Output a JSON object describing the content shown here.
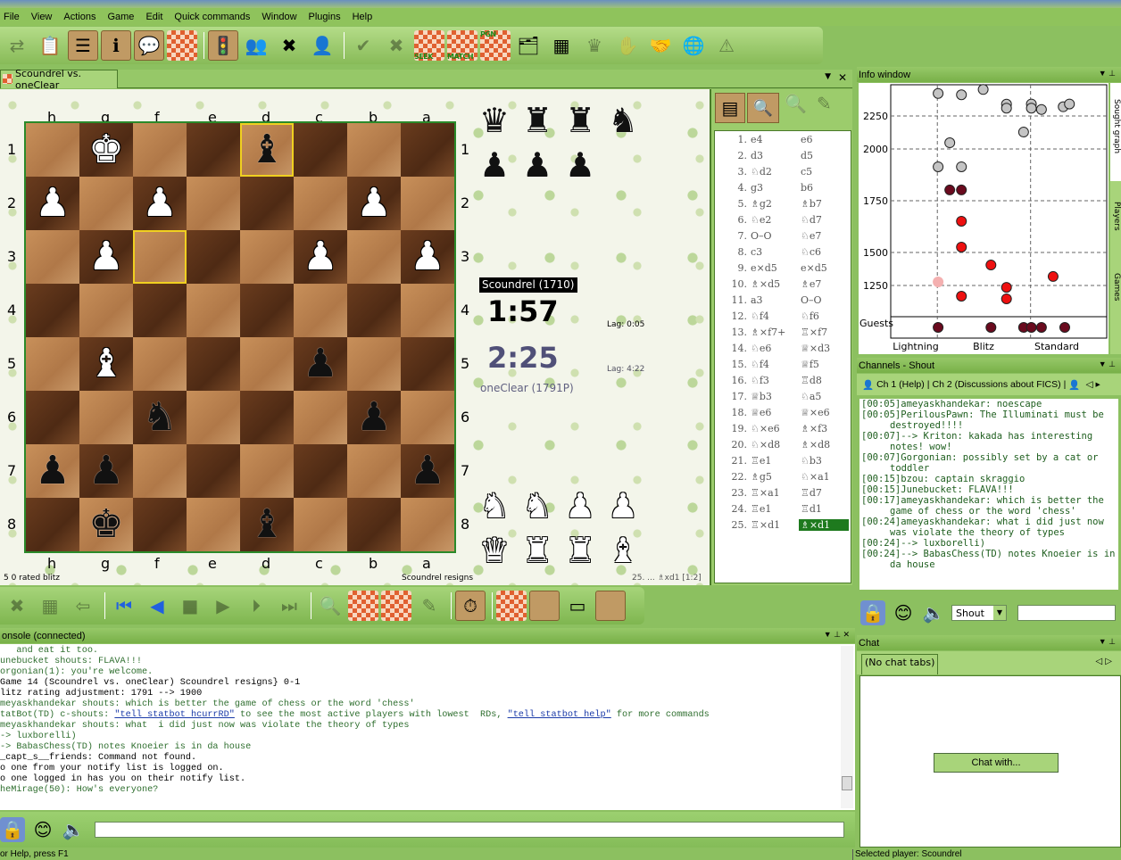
{
  "menu": [
    "File",
    "View",
    "Actions",
    "Game",
    "Edit",
    "Quick commands",
    "Window",
    "Plugins",
    "Help"
  ],
  "toolbar": {
    "seek_label": "SEEK",
    "match_label": "MATCH",
    "pgn_label": "PGN"
  },
  "game_tab": {
    "title": "Scoundrel vs. oneClear"
  },
  "board": {
    "files": [
      "h",
      "g",
      "f",
      "e",
      "d",
      "c",
      "b",
      "a"
    ],
    "ranks": [
      "1",
      "2",
      "3",
      "4",
      "5",
      "6",
      "7",
      "8"
    ],
    "rows": [
      ".K..b...",
      "P.P...P.",
      ".P...P.P",
      "........",
      ".B...p..",
      "..n...p.",
      "pp.....p",
      ".k..b..."
    ],
    "highlight_squares": [
      "d1",
      "f3"
    ],
    "captured_top": [
      [
        "q",
        "r",
        "r",
        "n"
      ],
      [
        "p",
        "p",
        "p"
      ]
    ],
    "captured_bottom": [
      [
        "N",
        "N",
        "P",
        "P"
      ],
      [
        "Q",
        "R",
        "R",
        "B"
      ]
    ]
  },
  "clocks": {
    "top_player": "Scoundrel (1710)",
    "top_time": "1:57",
    "top_lag": "Lag:  0:05",
    "bottom_player": "oneClear (1791P)",
    "bottom_time": "2:25",
    "bottom_lag": "Lag:  4:22"
  },
  "board_footer": {
    "game_type": "5 0 rated blitz",
    "result": "Scoundrel resigns",
    "last_move": "25. ... ♗xd1 [1:2]"
  },
  "moves": [
    [
      "e4",
      "e6"
    ],
    [
      "d3",
      "d5"
    ],
    [
      "♘d2",
      "c5"
    ],
    [
      "g3",
      "b6"
    ],
    [
      "♗g2",
      "♗b7"
    ],
    [
      "♘e2",
      "♘d7"
    ],
    [
      "O–O",
      "♘e7"
    ],
    [
      "c3",
      "♘c6"
    ],
    [
      "e×d5",
      "e×d5"
    ],
    [
      "♗×d5",
      "♗e7"
    ],
    [
      "a3",
      "O–O"
    ],
    [
      "♘f4",
      "♘f6"
    ],
    [
      "♗×f7+",
      "♖×f7"
    ],
    [
      "♘e6",
      "♕×d3"
    ],
    [
      "♘f4",
      "♕f5"
    ],
    [
      "♘f3",
      "♖d8"
    ],
    [
      "♕b3",
      "♘a5"
    ],
    [
      "♕e6",
      "♕×e6"
    ],
    [
      "♘×e6",
      "♗×f3"
    ],
    [
      "♘×d8",
      "♗×d8"
    ],
    [
      "♖e1",
      "♘b3"
    ],
    [
      "♗g5",
      "♘×a1"
    ],
    [
      "♖×a1",
      "♖d7"
    ],
    [
      "♖e1",
      "♖d1"
    ],
    [
      "♖×d1",
      "♗×d1"
    ]
  ],
  "selected_move": "♗×d1",
  "console": {
    "title": "onsole (connected)",
    "lines": [
      {
        "t": "   and eat it too.",
        "c": "g"
      },
      {
        "t": "unebucket shouts: FLAVA!!!",
        "c": "g"
      },
      {
        "t": "orgonian(1): you're welcome.",
        "c": "g"
      },
      {
        "t": "Game 14 (Scoundrel vs. oneClear) Scoundrel resigns} 0-1",
        "c": "k"
      },
      {
        "t": "litz rating adjustment: 1791 --> 1900",
        "c": "k"
      },
      {
        "t": "meyaskhandekar shouts: which is better the game of chess or the word 'chess'",
        "c": "g"
      },
      {
        "t": "tatBot(TD) c-shouts: ",
        "c": "g",
        "link1": "\"tell statbot hcurrRD\"",
        "mid": " to see the most active players with lowest  RDs, ",
        "link2": "\"tell statbot help\"",
        "end": " for more commands"
      },
      {
        "t": "meyaskhandekar shouts: what  i did just now was violate the theory of types",
        "c": "g"
      },
      {
        "t": "-> luxborelli)",
        "c": "g"
      },
      {
        "t": "-> BabasChess(TD) notes Knoeier is in da house",
        "c": "g"
      },
      {
        "t": "_capt_s__friends: Command not found.",
        "c": "k"
      },
      {
        "t": "o one from your notify list is logged on.",
        "c": "k"
      },
      {
        "t": "o one logged in has you on their notify list.",
        "c": "k"
      },
      {
        "t": "heMirage(50): How's everyone?",
        "c": "g"
      }
    ],
    "input_value": ""
  },
  "status": {
    "help": "or Help, press F1",
    "selected": "Selected player: Scoundrel"
  },
  "info_window": {
    "title": "Info window",
    "side_tabs": [
      "Sought graph",
      "Players",
      "Games"
    ],
    "graph": {
      "y_ticks": [
        2250,
        2000,
        1750,
        1500,
        1250
      ],
      "guests_label": "Guests",
      "x_labels": [
        "Lightning",
        "Blitz",
        "Standard"
      ],
      "colors": {
        "gray": "#c4c4c4",
        "dark": "#6a0a1e",
        "red": "#ee1010",
        "pink": "#f4b0b0"
      },
      "points": [
        {
          "x": 3.1,
          "r": 2365,
          "c": "gray"
        },
        {
          "x": 6.1,
          "r": 2358,
          "c": "gray"
        },
        {
          "x": 8.9,
          "r": 2385,
          "c": "gray"
        },
        {
          "x": 11.9,
          "r": 2310,
          "c": "gray"
        },
        {
          "x": 11.9,
          "r": 2290,
          "c": "gray"
        },
        {
          "x": 15.1,
          "r": 2311,
          "c": "gray"
        },
        {
          "x": 15.1,
          "r": 2290,
          "c": "gray"
        },
        {
          "x": 16.4,
          "r": 2283,
          "c": "gray"
        },
        {
          "x": 19.2,
          "r": 2297,
          "c": "gray"
        },
        {
          "x": 20,
          "r": 2311,
          "c": "gray"
        },
        {
          "x": 14.1,
          "r": 2128,
          "c": "gray"
        },
        {
          "x": 4.6,
          "r": 2047,
          "c": "gray"
        },
        {
          "x": 3.1,
          "r": 1914,
          "c": "gray"
        },
        {
          "x": 6.1,
          "r": 1914,
          "c": "gray"
        },
        {
          "x": 4.6,
          "r": 1802,
          "c": "dark"
        },
        {
          "x": 6.1,
          "r": 1802,
          "c": "dark"
        },
        {
          "x": 6.1,
          "r": 1651,
          "c": "red"
        },
        {
          "x": 6.1,
          "r": 1526,
          "c": "red"
        },
        {
          "x": 9.9,
          "r": 1405,
          "c": "red"
        },
        {
          "x": 17.9,
          "r": 1318,
          "c": "red"
        },
        {
          "x": 11.9,
          "r": 1236,
          "c": "red"
        },
        {
          "x": 6.1,
          "r": 1169,
          "c": "red"
        },
        {
          "x": 11.9,
          "r": 1149,
          "c": "red"
        },
        {
          "x": 3.1,
          "r": 1277,
          "c": "pink"
        }
      ],
      "guests": [
        3.1,
        9.9,
        14.1,
        15.1,
        16.4,
        19.4
      ]
    }
  },
  "channels": {
    "title": "Channels - Shout",
    "tabs": [
      "Ch 1 (Help)",
      "Ch 2 (Discussions about FICS)"
    ],
    "lines": [
      "[00:05]ameyaskhandekar: noescape",
      "[00:05]PerilousPawn: The Illuminati must be destroyed!!!!",
      "[00:07]--> Kriton: kakada has interesting notes! wow!",
      "[00:07]Gorgonian: possibly set by a cat or toddler",
      "[00:15]bzou: captain skraggio",
      "[00:15]Junebucket: FLAVA!!!",
      "[00:17]ameyaskhandekar: which is better the game of chess or the word 'chess'",
      "[00:24]ameyaskhandekar: what  i did just now was violate the theory of types",
      "[00:24]--> luxborelli)",
      "[00:24]--> BabasChess(TD) notes Knoeier is in da house"
    ],
    "shout_select": "Shout",
    "shout_input": ""
  },
  "chat": {
    "title": "Chat",
    "tab": "(No chat tabs)",
    "chat_with": "Chat with..."
  }
}
